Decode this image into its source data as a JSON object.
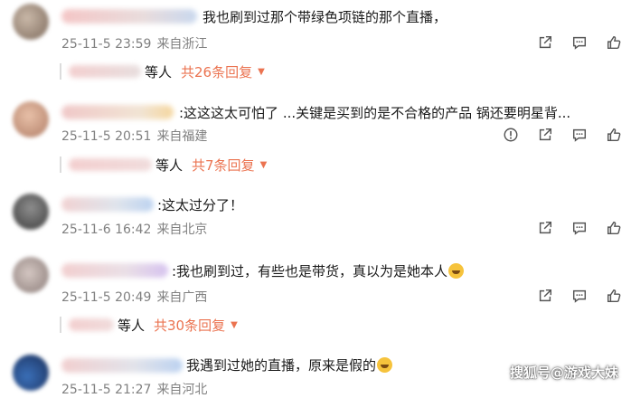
{
  "comments": [
    {
      "text": "我也刷到过那个带绿色项链的那个直播，",
      "time": "25-11-5 23:59",
      "location": "来自浙江",
      "replies": {
        "who": "等人",
        "count": "共26条回复"
      },
      "actions": [
        "share-icon",
        "comment-icon",
        "like-icon"
      ]
    },
    {
      "text": ":这这这太可怕了 ...关键是买到的是不合格的产品 锅还要明星背...",
      "time": "25-11-5 20:51",
      "location": "来自福建",
      "replies": {
        "who": "等人",
        "count": "共7条回复"
      },
      "actions": [
        "report-icon",
        "share-icon",
        "comment-icon",
        "like-icon"
      ]
    },
    {
      "text": ":这太过分了！",
      "time": "25-11-6 16:42",
      "location": "来自北京",
      "actions": [
        "share-icon",
        "comment-icon",
        "like-icon"
      ]
    },
    {
      "text": ":我也刷到过，有些也是带货，真以为是她本人",
      "time": "25-11-5 20:49",
      "location": "来自广西",
      "replies": {
        "who": "等人",
        "count": "共30条回复"
      },
      "actions": [
        "share-icon",
        "comment-icon",
        "like-icon"
      ]
    },
    {
      "text": "我遇到过她的直播，原来是假的",
      "time": "25-11-5 21:27",
      "location": "来自河北"
    }
  ],
  "watermark": "搜狐号@游戏大妹",
  "colors": {
    "accent": "#eb7350",
    "meta": "#808080"
  }
}
